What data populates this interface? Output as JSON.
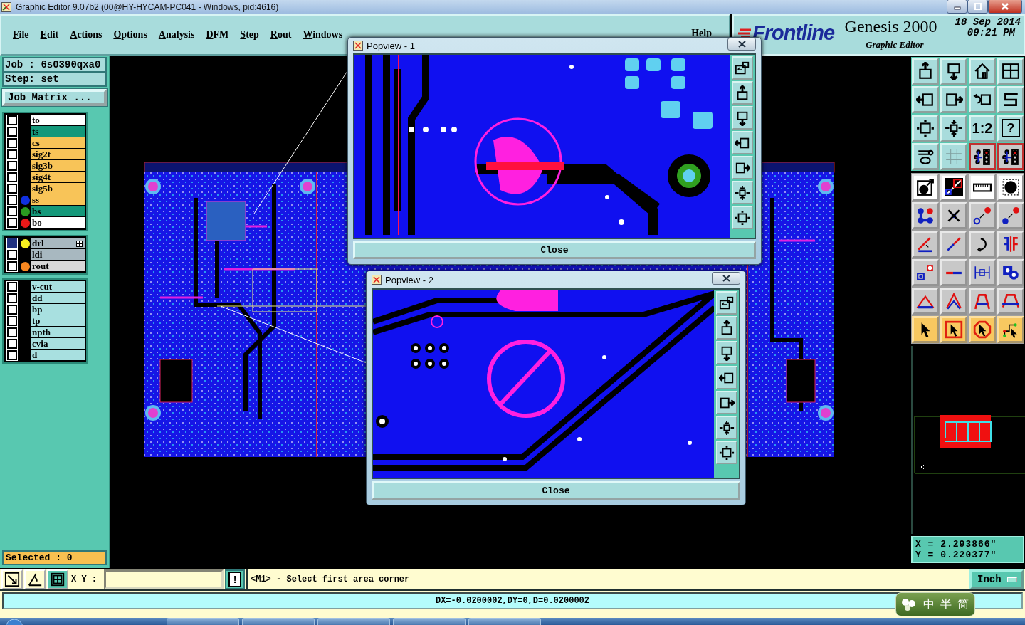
{
  "window": {
    "title": "Graphic Editor 9.07b2 (00@HY-HYCAM-PC041 - Windows, pid:4616)"
  },
  "menu": [
    "File",
    "Edit",
    "Actions",
    "Options",
    "Analysis",
    "DFM",
    "Step",
    "Rout",
    "Windows",
    "Help"
  ],
  "branding": {
    "logo": "Frontline",
    "product": "Genesis 2000",
    "subtitle": "Graphic Editor",
    "date": "18 Sep 2014",
    "time": "09:21 PM"
  },
  "job": {
    "job": "Job : 6s0390qxa0",
    "step": "Step: set",
    "matrix_button": "Job Matrix ..."
  },
  "layer_groups": [
    [
      {
        "name": "to",
        "kind": "silk",
        "active": false
      },
      {
        "name": "ts",
        "kind": "mask",
        "active": false
      },
      {
        "name": "cs",
        "kind": "signal",
        "active": false
      },
      {
        "name": "sig2t",
        "kind": "signal",
        "active": false
      },
      {
        "name": "sig3b",
        "kind": "signal",
        "active": false
      },
      {
        "name": "sig4t",
        "kind": "signal",
        "active": false
      },
      {
        "name": "sig5b",
        "kind": "signal",
        "active": false
      },
      {
        "name": "ss",
        "kind": "signal",
        "color": "#1030e0",
        "active": false
      },
      {
        "name": "bs",
        "kind": "mask",
        "color": "#2a9a20",
        "active": false
      },
      {
        "name": "bo",
        "kind": "silk",
        "color": "#e81818",
        "active": false
      }
    ],
    [
      {
        "name": "drl",
        "kind": "drill",
        "color": "#f8f020",
        "active": true
      },
      {
        "name": "ldi",
        "kind": "drill",
        "active": false
      },
      {
        "name": "rout",
        "kind": "rout",
        "color": "#f88820",
        "active": false
      }
    ],
    [
      {
        "name": "v-cut",
        "kind": "document",
        "active": false
      },
      {
        "name": "dd",
        "kind": "document",
        "active": false
      },
      {
        "name": "bp",
        "kind": "document",
        "active": false
      },
      {
        "name": "tp",
        "kind": "document",
        "active": false
      },
      {
        "name": "npth",
        "kind": "document",
        "active": false
      },
      {
        "name": "cvia",
        "kind": "document",
        "active": false
      },
      {
        "name": "d",
        "kind": "document",
        "active": false
      }
    ]
  ],
  "selected": "Selected : 0",
  "toolbar_texts": {
    "ratio": "1:2",
    "help": "?"
  },
  "popviews": [
    {
      "title": "Popview - 1",
      "close": "Close"
    },
    {
      "title": "Popview - 2",
      "close": "Close"
    }
  ],
  "coords": {
    "x": "X = 2.293866\"",
    "y": "Y = 0.220377\""
  },
  "command": {
    "xy_label": "X Y :",
    "info": "!",
    "message": "<M1> - Select first area corner",
    "units": "Inch"
  },
  "status": "DX=-0.0200002,DY=0,D=0.0200002",
  "ime": [
    "中",
    "半",
    "简"
  ]
}
